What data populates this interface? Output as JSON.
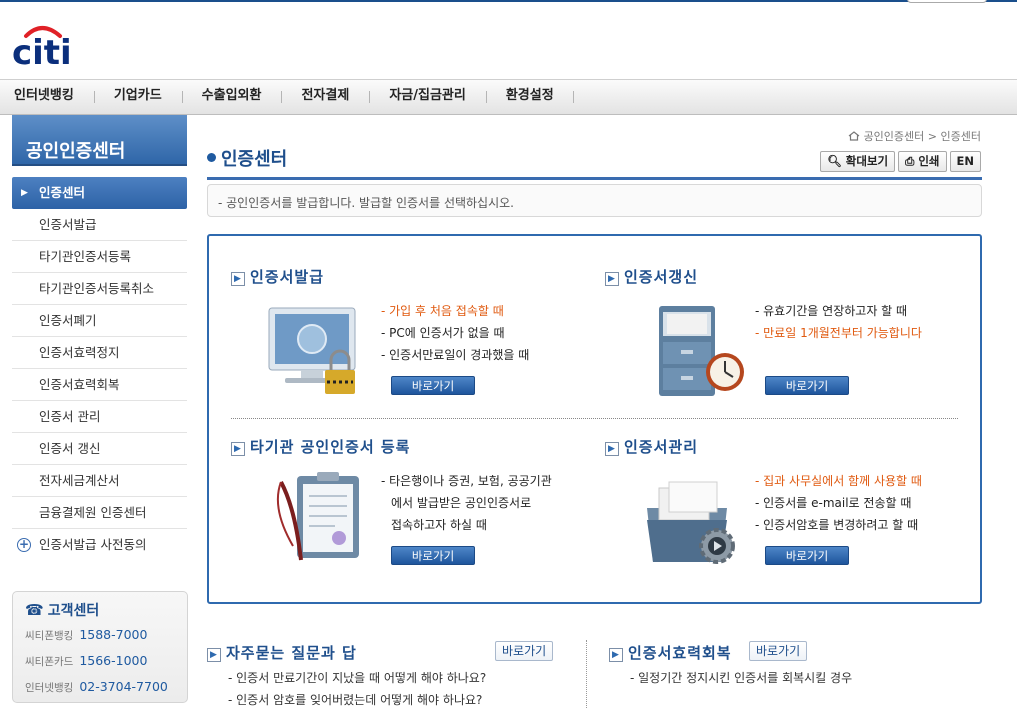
{
  "logo": "citi",
  "gnb": [
    "인터넷뱅킹",
    "기업카드",
    "수출입외환",
    "전자결제",
    "자금/집금관리",
    "환경설정"
  ],
  "lnb": {
    "title": "공인인증센터",
    "items": [
      "인증센터",
      "인증서발급",
      "타기관인증서등록",
      "타기관인증서등록취소",
      "인증서폐기",
      "인증서효력정지",
      "인증서효력회복",
      "인증서 관리",
      "인증서 갱신",
      "전자세금계산서",
      "금융결제원 인증센터",
      "인증서발급 사전동의"
    ]
  },
  "customer_center": {
    "title": "고객센터",
    "rows": [
      {
        "label": "씨티폰뱅킹",
        "number": "1588-7000"
      },
      {
        "label": "씨티폰카드",
        "number": "1566-1000"
      },
      {
        "label": "인터넷뱅킹",
        "number": "02-3704-7700"
      }
    ]
  },
  "breadcrumb": [
    "공인인증센터",
    "인증센터"
  ],
  "page_title": "인증센터",
  "utility": {
    "zoom": "확대보기",
    "print": "인쇄",
    "lang": "EN"
  },
  "notice": "- 공인인증서를 발급합니다. 발급할 인증서를 선택하십시오.",
  "go_label": "바로가기",
  "cards": {
    "issue": {
      "title": "인증서발급",
      "lines": [
        "- 가입 후 처음 접속할 때",
        "- PC에 인증서가 없을 때",
        "- 인증서만료일이 경과했을 때"
      ]
    },
    "renew": {
      "title": "인증서갱신",
      "lines": [
        "- 유효기간을 연장하고자 할 때",
        "- 만료일 1개월전부터 가능합니다"
      ]
    },
    "register": {
      "title": "타기관 공인인증서 등록",
      "lines": [
        "- 타은행이나 증권, 보험, 공공기관",
        "에서 발급받은 공인인증서로",
        "접속하고자 하실 때"
      ]
    },
    "manage": {
      "title": "인증서관리",
      "lines": [
        "- 집과 사무실에서 함께 사용할 때",
        "- 인증서를 e-mail로 전송할 때",
        "- 인증서암호를 변경하려고 할 때"
      ]
    }
  },
  "faq": {
    "title": "자주묻는 질문과 답",
    "lines": [
      "- 인증서 만료기간이 지났을 때 어떻게 해야 하나요?",
      "- 인증서 암호를 잊어버렸는데 어떻게 해야 하나요?"
    ]
  },
  "restore": {
    "title": "인증서효력회복",
    "lines": [
      "- 일정기간 정지시킨 인증서를 회복시킬 경우"
    ]
  },
  "colors": {
    "brand": "#1f4f8c",
    "accent": "#2f6aaf",
    "highlight": "#e05a10"
  }
}
